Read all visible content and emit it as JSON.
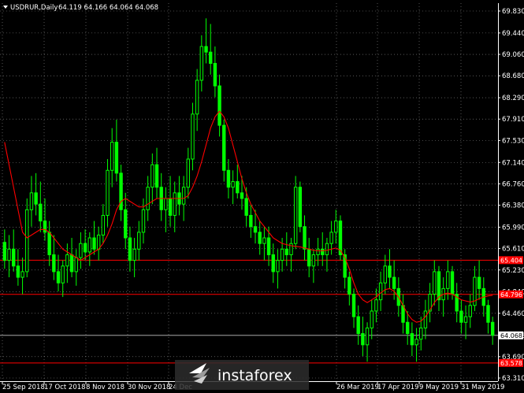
{
  "header": {
    "symbol": "USDRUR,Daily",
    "ohlc": "64.119 64.166 64.064 64.068"
  },
  "colors": {
    "background": "#000000",
    "candle": "#00ff00",
    "ma": "#ff0000",
    "level": "#ff0000",
    "current_price": "#c0c0c0",
    "grid": "#ffffff",
    "axis": "#ffffff",
    "level_badge": "#ff0000"
  },
  "logo": {
    "text": "instaforex",
    "icon": "instaforex-bird-icon"
  },
  "chart_data": {
    "type": "candlestick",
    "title": "USDRUR,Daily",
    "ylim": [
      63.31,
      69.83
    ],
    "y_ticks": [
      "69.830",
      "69.440",
      "69.060",
      "68.680",
      "68.290",
      "67.910",
      "67.530",
      "67.140",
      "66.760",
      "66.380",
      "65.990",
      "65.610",
      "65.230",
      "64.840",
      "64.460",
      "64.068",
      "63.690",
      "63.310"
    ],
    "x_ticks": [
      "25 Sep 2018",
      "17 Oct 2018",
      "8 Nov 2018",
      "30 Nov 2018",
      "24 Dec",
      "26 Mar 2019",
      "17 Apr 2019",
      "9 May 2019",
      "31 May 2019"
    ],
    "grid": true,
    "levels": [
      {
        "value": 65.404,
        "label": "65.404"
      },
      {
        "value": 64.796,
        "label": "64.796"
      },
      {
        "value": 63.578,
        "label": "63.578"
      }
    ],
    "current_price": {
      "value": 64.068,
      "label": "64.068"
    },
    "series": [
      {
        "type": "candles",
        "bars": [
          [
            65.72,
            65.95,
            65.25,
            65.4
          ],
          [
            65.4,
            65.85,
            65.1,
            65.6
          ],
          [
            65.6,
            65.95,
            65.2,
            65.3
          ],
          [
            65.3,
            65.6,
            64.95,
            65.1
          ],
          [
            65.1,
            65.45,
            64.8,
            65.2
          ],
          [
            65.2,
            66.5,
            65.1,
            66.3
          ],
          [
            66.3,
            66.9,
            66.0,
            66.6
          ],
          [
            66.6,
            66.95,
            66.2,
            66.4
          ],
          [
            66.4,
            66.8,
            65.9,
            66.1
          ],
          [
            66.1,
            66.5,
            65.75,
            65.9
          ],
          [
            65.9,
            66.1,
            65.3,
            65.5
          ],
          [
            65.5,
            65.85,
            65.05,
            65.2
          ],
          [
            65.2,
            65.5,
            64.85,
            65.0
          ],
          [
            65.0,
            65.4,
            64.75,
            65.3
          ],
          [
            65.3,
            65.7,
            65.0,
            65.5
          ],
          [
            65.5,
            65.8,
            65.1,
            65.2
          ],
          [
            65.2,
            65.6,
            64.95,
            65.45
          ],
          [
            65.45,
            65.9,
            65.25,
            65.7
          ],
          [
            65.7,
            65.95,
            65.4,
            65.55
          ],
          [
            65.55,
            65.9,
            65.3,
            65.8
          ],
          [
            65.8,
            66.1,
            65.5,
            65.6
          ],
          [
            65.6,
            66.0,
            65.4,
            65.85
          ],
          [
            65.85,
            66.4,
            65.7,
            66.2
          ],
          [
            66.2,
            67.2,
            66.0,
            67.0
          ],
          [
            67.0,
            67.75,
            66.7,
            67.5
          ],
          [
            67.5,
            67.9,
            66.8,
            66.95
          ],
          [
            66.95,
            67.1,
            66.1,
            66.3
          ],
          [
            66.3,
            66.6,
            65.6,
            65.8
          ],
          [
            65.8,
            66.0,
            65.2,
            65.4
          ],
          [
            65.4,
            65.8,
            65.1,
            65.6
          ],
          [
            65.6,
            66.1,
            65.4,
            65.9
          ],
          [
            65.9,
            66.5,
            65.7,
            66.3
          ],
          [
            66.3,
            66.9,
            66.1,
            66.7
          ],
          [
            66.7,
            67.3,
            66.4,
            67.1
          ],
          [
            67.1,
            67.4,
            66.5,
            66.7
          ],
          [
            66.7,
            66.95,
            66.1,
            66.3
          ],
          [
            66.3,
            66.7,
            65.9,
            66.5
          ],
          [
            66.5,
            66.9,
            66.0,
            66.2
          ],
          [
            66.2,
            66.8,
            65.9,
            66.6
          ],
          [
            66.6,
            66.9,
            66.2,
            66.4
          ],
          [
            66.4,
            66.9,
            66.1,
            66.7
          ],
          [
            66.7,
            67.4,
            66.5,
            67.2
          ],
          [
            67.2,
            68.2,
            67.0,
            68.0
          ],
          [
            68.0,
            68.8,
            67.7,
            68.6
          ],
          [
            68.6,
            69.4,
            68.4,
            69.2
          ],
          [
            69.2,
            69.7,
            68.9,
            69.1
          ],
          [
            69.1,
            69.6,
            68.7,
            68.9
          ],
          [
            68.9,
            69.2,
            68.3,
            68.5
          ],
          [
            68.5,
            68.7,
            67.6,
            67.8
          ],
          [
            67.8,
            67.9,
            66.8,
            67.0
          ],
          [
            67.0,
            67.2,
            66.5,
            66.7
          ],
          [
            66.7,
            67.0,
            66.4,
            66.8
          ],
          [
            66.8,
            67.1,
            66.5,
            66.6
          ],
          [
            66.6,
            66.9,
            66.3,
            66.5
          ],
          [
            66.5,
            66.7,
            66.0,
            66.2
          ],
          [
            66.2,
            66.4,
            65.8,
            66.0
          ],
          [
            66.0,
            66.3,
            65.7,
            65.9
          ],
          [
            65.9,
            66.1,
            65.5,
            65.7
          ],
          [
            65.7,
            66.0,
            65.4,
            65.8
          ],
          [
            65.8,
            66.0,
            65.3,
            65.5
          ],
          [
            65.5,
            65.7,
            65.0,
            65.2
          ],
          [
            65.2,
            65.6,
            64.9,
            65.4
          ],
          [
            65.4,
            65.8,
            65.2,
            65.6
          ],
          [
            65.6,
            65.9,
            65.3,
            65.5
          ],
          [
            65.5,
            65.8,
            65.2,
            65.7
          ],
          [
            65.7,
            66.9,
            65.6,
            66.7
          ],
          [
            66.7,
            66.8,
            65.9,
            66.0
          ],
          [
            66.0,
            66.2,
            65.4,
            65.6
          ],
          [
            65.6,
            65.8,
            65.1,
            65.3
          ],
          [
            65.3,
            65.6,
            65.0,
            65.5
          ],
          [
            65.5,
            65.8,
            65.3,
            65.6
          ],
          [
            65.6,
            65.9,
            65.3,
            65.5
          ],
          [
            65.5,
            65.8,
            65.2,
            65.7
          ],
          [
            65.7,
            66.1,
            65.5,
            65.9
          ],
          [
            65.9,
            66.3,
            65.7,
            66.1
          ],
          [
            66.1,
            66.2,
            65.4,
            65.5
          ],
          [
            65.5,
            65.6,
            64.9,
            65.1
          ],
          [
            65.1,
            65.2,
            64.6,
            64.8
          ],
          [
            64.8,
            64.9,
            64.2,
            64.4
          ],
          [
            64.4,
            64.6,
            63.9,
            64.1
          ],
          [
            64.1,
            64.4,
            63.7,
            63.9
          ],
          [
            63.9,
            64.3,
            63.6,
            64.2
          ],
          [
            64.2,
            64.7,
            64.0,
            64.5
          ],
          [
            64.5,
            64.9,
            64.3,
            64.7
          ],
          [
            64.7,
            65.2,
            64.5,
            65.0
          ],
          [
            65.0,
            65.5,
            64.8,
            65.3
          ],
          [
            65.3,
            65.6,
            64.9,
            65.1
          ],
          [
            65.1,
            65.4,
            64.7,
            64.9
          ],
          [
            64.9,
            65.1,
            64.4,
            64.6
          ],
          [
            64.6,
            64.8,
            64.1,
            64.3
          ],
          [
            64.3,
            64.5,
            63.9,
            64.1
          ],
          [
            64.1,
            64.3,
            63.7,
            63.9
          ],
          [
            63.9,
            64.2,
            63.6,
            64.0
          ],
          [
            64.0,
            64.4,
            63.8,
            64.2
          ],
          [
            64.2,
            64.7,
            64.0,
            64.5
          ],
          [
            64.5,
            65.0,
            64.3,
            64.8
          ],
          [
            64.8,
            65.4,
            64.6,
            65.2
          ],
          [
            65.2,
            65.3,
            64.5,
            64.7
          ],
          [
            64.7,
            65.1,
            64.4,
            64.9
          ],
          [
            64.9,
            65.4,
            64.7,
            65.2
          ],
          [
            65.2,
            65.3,
            64.7,
            64.8
          ],
          [
            64.8,
            65.0,
            64.3,
            64.5
          ],
          [
            64.5,
            64.7,
            64.1,
            64.3
          ],
          [
            64.3,
            64.6,
            64.0,
            64.4
          ],
          [
            64.4,
            64.8,
            64.2,
            64.6
          ],
          [
            64.6,
            65.3,
            64.5,
            65.1
          ],
          [
            65.1,
            65.4,
            64.7,
            64.9
          ],
          [
            64.9,
            65.1,
            64.4,
            64.6
          ],
          [
            64.6,
            64.7,
            64.1,
            64.3
          ],
          [
            64.3,
            64.4,
            63.9,
            64.07
          ]
        ]
      },
      {
        "type": "line",
        "name": "",
        "values": [
          67.5,
          67.1,
          66.7,
          66.3,
          65.9,
          65.8,
          65.85,
          65.9,
          65.95,
          65.95,
          65.9,
          65.8,
          65.7,
          65.6,
          65.55,
          65.5,
          65.45,
          65.4,
          65.45,
          65.5,
          65.55,
          65.6,
          65.7,
          65.85,
          66.05,
          66.3,
          66.45,
          66.5,
          66.45,
          66.4,
          66.35,
          66.35,
          66.4,
          66.45,
          66.5,
          66.5,
          66.5,
          66.5,
          66.5,
          66.5,
          66.5,
          66.55,
          66.7,
          66.9,
          67.15,
          67.45,
          67.75,
          67.95,
          68.05,
          67.95,
          67.75,
          67.45,
          67.15,
          66.85,
          66.6,
          66.4,
          66.25,
          66.1,
          66.0,
          65.9,
          65.8,
          65.75,
          65.7,
          65.68,
          65.66,
          65.65,
          65.64,
          65.62,
          65.6,
          65.58,
          65.57,
          65.57,
          65.58,
          65.6,
          65.62,
          65.58,
          65.45,
          65.25,
          65.0,
          64.8,
          64.7,
          64.65,
          64.7,
          64.75,
          64.82,
          64.88,
          64.9,
          64.85,
          64.75,
          64.6,
          64.45,
          64.35,
          64.3,
          64.32,
          64.4,
          64.52,
          64.65,
          64.75,
          64.8,
          64.82,
          64.8,
          64.75,
          64.7,
          64.68,
          64.66,
          64.68,
          64.72,
          64.75,
          64.77,
          64.78
        ]
      }
    ]
  }
}
